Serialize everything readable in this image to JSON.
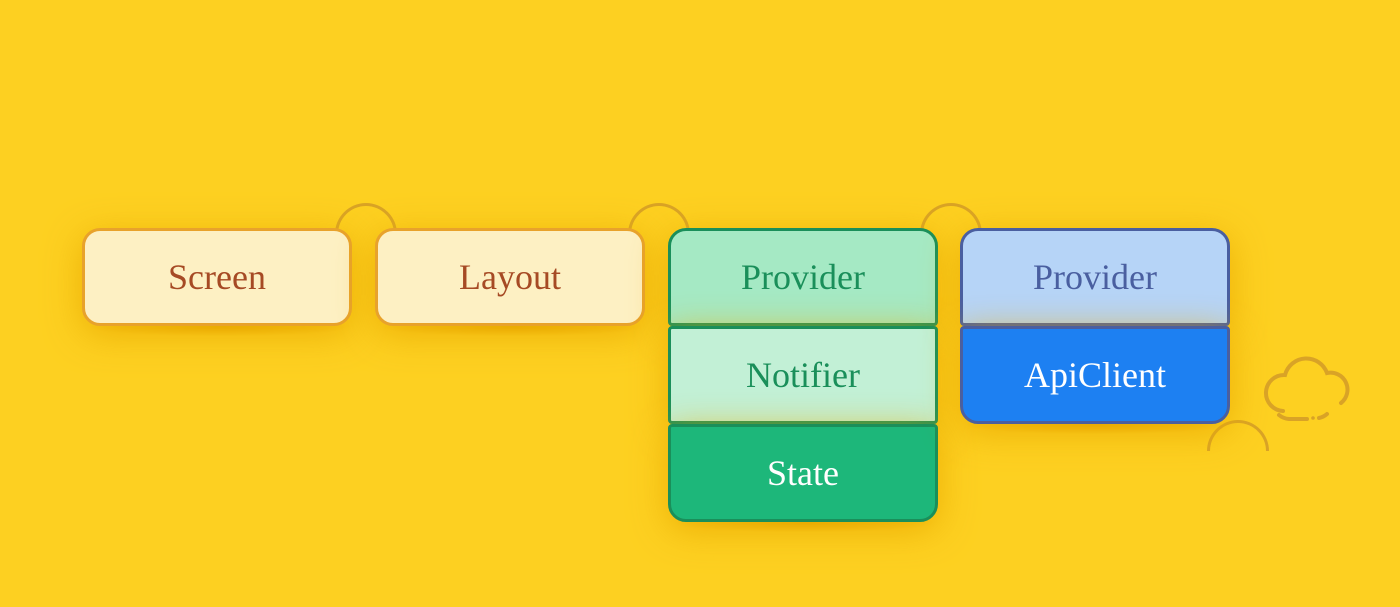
{
  "bg_color": "#fdd021",
  "boxes": {
    "screen": {
      "label": "Screen",
      "bg": "#fdf0c3",
      "border": "#e8a22b",
      "text": "#a64a24"
    },
    "layout": {
      "label": "Layout",
      "bg": "#fdf0c3",
      "border": "#e8a22b",
      "text": "#a64a24"
    },
    "provider1": {
      "label": "Provider",
      "bg": "#a5e9c4",
      "border": "#1a8f5a",
      "text": "#1a8f5a"
    },
    "notifier": {
      "label": "Notifier",
      "bg": "#c2f0d6",
      "border": "#1a8f5a",
      "text": "#1a8f5a"
    },
    "state": {
      "label": "State",
      "bg": "#1db77a",
      "border": "#1a8f5a",
      "text": "#ffffff"
    },
    "provider2": {
      "label": "Provider",
      "bg": "#b6d4f7",
      "border": "#4a5fa0",
      "text": "#4a5fa0"
    },
    "apiclient": {
      "label": "ApiClient",
      "bg": "#1d80f2",
      "border": "#4a5fa0",
      "text": "#ffffff"
    }
  },
  "arc_colors": {
    "yellow": "#d9a326",
    "green": "#1a8f5a",
    "blue": "#4a5fa0"
  },
  "cloud_color": "#d9a326"
}
